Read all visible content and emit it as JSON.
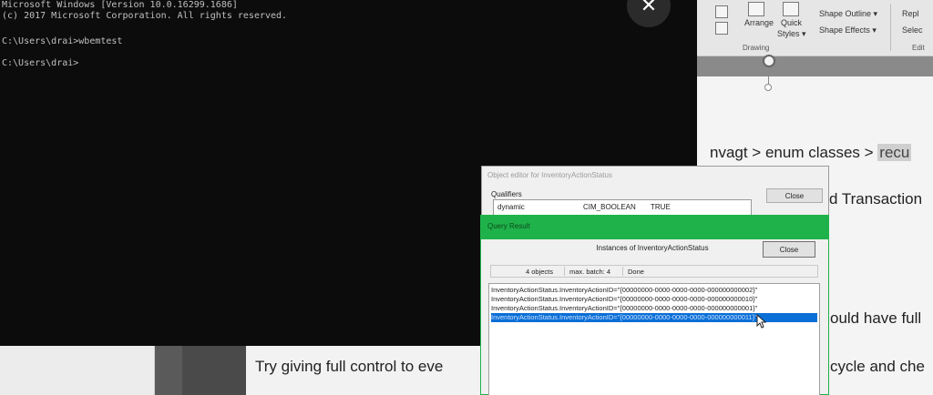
{
  "cmd": {
    "lines": [
      "Microsoft Windows [Version 10.0.16299.1686]",
      "(c) 2017 Microsoft Corporation. All rights reserved.",
      "",
      "C:\\Users\\drai>wbemtest",
      "",
      "C:\\Users\\drai>"
    ]
  },
  "overlay": {
    "close_glyph": "✕"
  },
  "ppt": {
    "ribbon": {
      "arrange": "Arrange",
      "quick_styles": "Quick",
      "quick_styles_2": "Styles ▾",
      "shape_outline": "Shape Outline ▾",
      "shape_effects": "Shape Effects ▾",
      "replace": "Repl",
      "select": "Selec",
      "drawing_group": "Drawing",
      "editing_group": "Edit"
    },
    "slide_lines": [
      "nvagt > enum classes > ",
      "recu",
      "d Transaction",
      "ould have full",
      "cycle and che"
    ],
    "bottom_line": "Try giving full control to eve"
  },
  "object_editor": {
    "title": "Object editor for InventoryActionStatus",
    "qualifiers_label": "Qualifiers",
    "qualifier_row": {
      "name": "dynamic",
      "type": "CIM_BOOLEAN",
      "value": "TRUE"
    },
    "close_label": "Close"
  },
  "query_result": {
    "title": "Query Result",
    "heading": "Instances of InventoryActionStatus",
    "close_label": "Close",
    "status": {
      "objects": "4 objects",
      "max_batch": "max. batch: 4",
      "state": "Done"
    },
    "rows": [
      {
        "text": "InventoryActionStatus.InventoryActionID=\"{00000000-0000-0000-0000-000000000002}\"",
        "selected": false
      },
      {
        "text": "InventoryActionStatus.InventoryActionID=\"{00000000-0000-0000-0000-000000000010}\"",
        "selected": false
      },
      {
        "text": "InventoryActionStatus.InventoryActionID=\"{00000000-0000-0000-0000-000000000001}\"",
        "selected": false
      },
      {
        "text": "InventoryActionStatus.InventoryActionID=\"{00000000-0000-0000-0000-000000000011}\"",
        "selected": true
      }
    ]
  },
  "colors": {
    "cmd_bg": "#0c0c0c",
    "cmd_text": "#c0c0c0",
    "query_titlebar": "#1fb24a",
    "selection": "#0a6fd6"
  }
}
